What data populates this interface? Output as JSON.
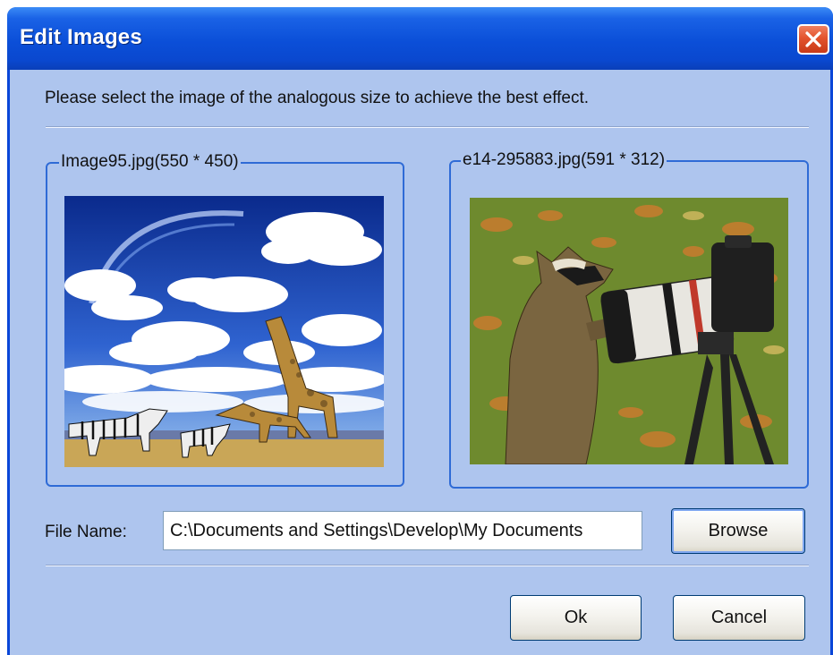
{
  "window": {
    "title": "Edit Images",
    "close_icon": "close-icon"
  },
  "instruction": "Please select the image of the analogous size to achieve the best effect.",
  "left_image": {
    "caption": "Image95.jpg(550 * 450)",
    "content": "giraffes-zebras-photo"
  },
  "right_image": {
    "caption": "e14-295883.jpg(591 * 312)",
    "content": "raccoon-camera-photo"
  },
  "file": {
    "label": "File Name:",
    "value": "C:\\Documents and Settings\\Develop\\My Documents"
  },
  "buttons": {
    "browse": "Browse",
    "ok": "Ok",
    "cancel": "Cancel"
  },
  "colors": {
    "titlebar": "#0a4fd8",
    "dialog_body": "#aec5ee",
    "groupbox_border": "#2f6bd6",
    "close_button": "#e3532d"
  }
}
